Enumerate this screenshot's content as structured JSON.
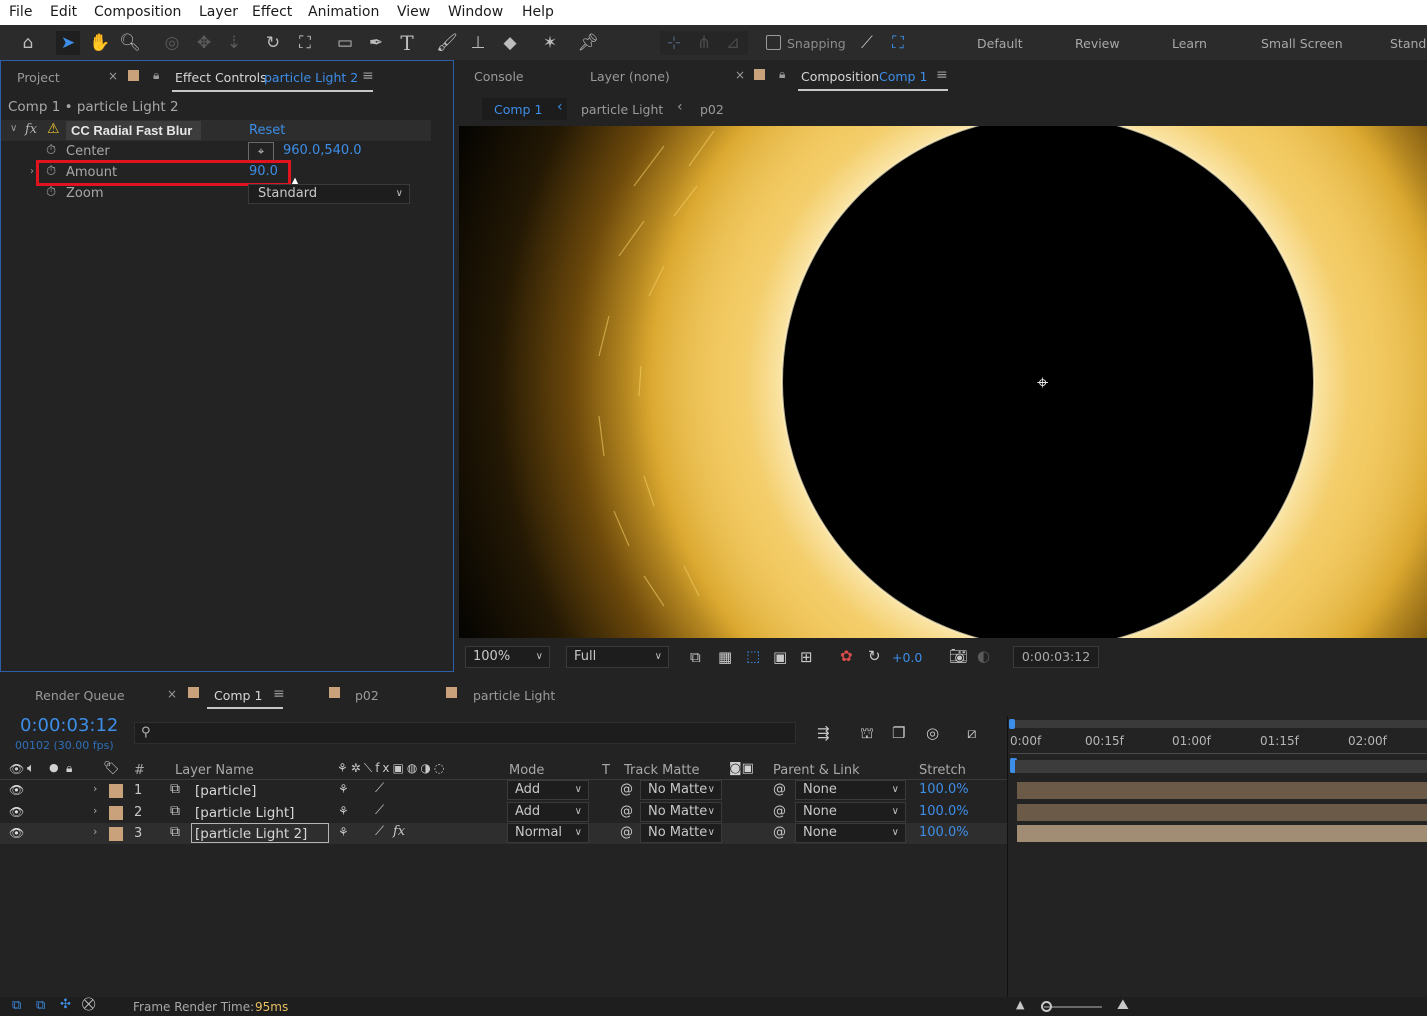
{
  "menu": [
    "File",
    "Edit",
    "Composition",
    "Layer",
    "Effect",
    "Animation",
    "View",
    "Window",
    "Help"
  ],
  "toolbar": {
    "snapping_label": "Snapping",
    "workspaces": [
      "Default",
      "Review",
      "Learn",
      "Small Screen",
      "Standa"
    ]
  },
  "left_panel": {
    "tab_project": "Project",
    "tab_effect_controls": "Effect Controls",
    "tab_effect_controls_layer": "particle Light 2",
    "breadcrumb": "Comp 1 • particle Light 2",
    "effect_name": "CC Radial Fast Blur",
    "reset_label": "Reset",
    "params": {
      "center_label": "Center",
      "center_value": "960.0,540.0",
      "amount_label": "Amount",
      "amount_value": "90.0",
      "zoom_label": "Zoom",
      "zoom_value": "Standard"
    }
  },
  "viewer": {
    "tab_console": "Console",
    "tab_layer": "Layer (none)",
    "tab_composition": "Composition",
    "tab_composition_name": "Comp 1",
    "crumbs": [
      "Comp 1",
      "particle Light",
      "p02"
    ],
    "zoom": "100%",
    "resolution": "Full",
    "exposure": "+0.0",
    "timecode": "0:00:03:12"
  },
  "timeline": {
    "tab_render_queue": "Render Queue",
    "tab_comp1": "Comp 1",
    "tab_p02": "p02",
    "tab_particle_light": "particle Light",
    "timecode": "0:00:03:12",
    "frame_info": "00102 (30.00 fps)",
    "search_placeholder": "",
    "columns": {
      "num": "#",
      "layer_name": "Layer Name",
      "mode": "Mode",
      "t": "T",
      "track_matte": "Track Matte",
      "parent_link": "Parent & Link",
      "stretch": "Stretch"
    },
    "ruler": [
      "0:00f",
      "00:15f",
      "01:00f",
      "01:15f",
      "02:00f"
    ],
    "layers": [
      {
        "num": "1",
        "name": "[particle]",
        "mode": "Add",
        "matte": "No Matte",
        "parent": "None",
        "stretch": "100.0%"
      },
      {
        "num": "2",
        "name": "[particle Light]",
        "mode": "Add",
        "matte": "No Matte",
        "parent": "None",
        "stretch": "100.0%"
      },
      {
        "num": "3",
        "name": "[particle Light 2]",
        "mode": "Normal",
        "matte": "No Matte",
        "parent": "None",
        "stretch": "100.0%"
      }
    ]
  },
  "status": {
    "frame_render_label": "Frame Render Time:",
    "frame_render_value": "95ms"
  },
  "colors": {
    "accent_blue": "#3d8ee8",
    "highlight_red": "#e0141e",
    "label_tan": "#c9a27c"
  }
}
